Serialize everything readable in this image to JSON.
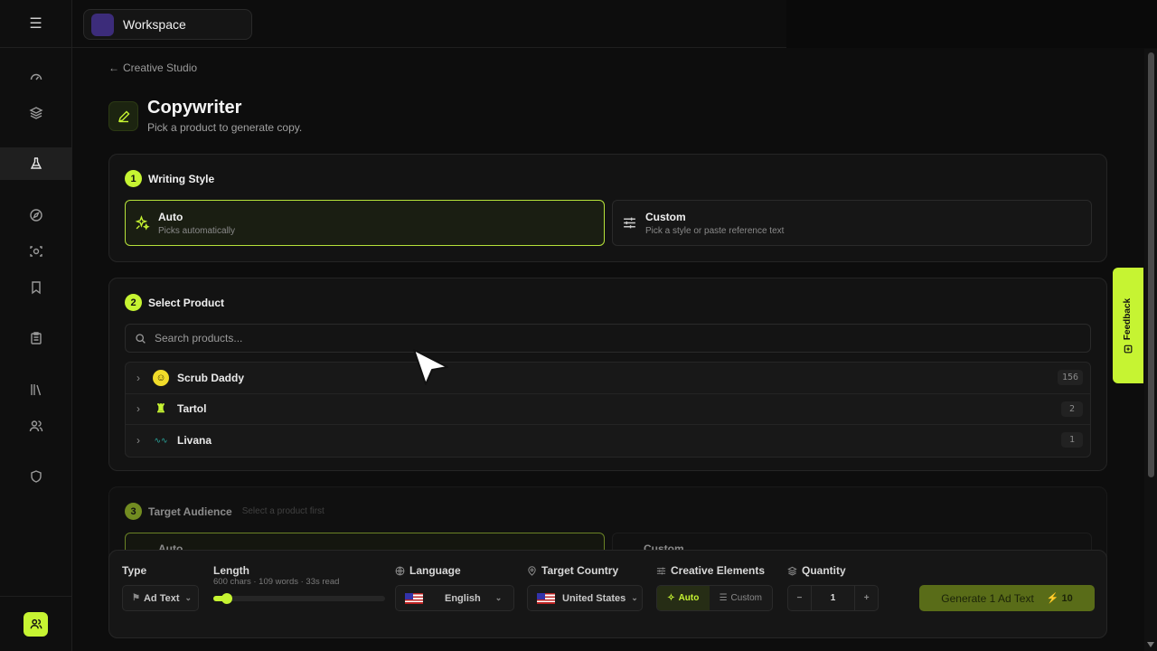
{
  "workspace": {
    "label": "Workspace"
  },
  "breadcrumb": {
    "back_label": "Creative Studio"
  },
  "page": {
    "title": "Copywriter",
    "subtitle": "Pick a product to generate copy."
  },
  "step1": {
    "num": "1",
    "title": "Writing Style",
    "options": [
      {
        "title": "Auto",
        "desc": "Picks automatically",
        "icon": "sparkles-icon",
        "selected": true
      },
      {
        "title": "Custom",
        "desc": "Pick a style or paste reference text",
        "icon": "sliders-icon",
        "selected": false
      }
    ]
  },
  "step2": {
    "num": "2",
    "title": "Select Product",
    "search_placeholder": "Search products...",
    "products": [
      {
        "name": "Scrub Daddy",
        "count": "156",
        "logo": "smiley-logo"
      },
      {
        "name": "Tartol",
        "count": "2",
        "logo": "castle-logo"
      },
      {
        "name": "Livana",
        "count": "1",
        "logo": "wave-logo"
      }
    ]
  },
  "step3": {
    "num": "3",
    "title": "Target Audience",
    "hint": "Select a product first",
    "options": [
      {
        "title": "Auto"
      },
      {
        "title": "Custom"
      }
    ]
  },
  "bottombar": {
    "type": {
      "label": "Type",
      "value": "Ad Text"
    },
    "length": {
      "label": "Length",
      "detail": "600 chars · 109 words · 33s read",
      "level": 0.05
    },
    "language": {
      "label": "Language",
      "value": "English"
    },
    "country": {
      "label": "Target Country",
      "value": "United States"
    },
    "elements": {
      "label": "Creative Elements",
      "auto": "Auto",
      "custom": "Custom"
    },
    "quantity": {
      "label": "Quantity",
      "minus": "−",
      "value": "1",
      "plus": "+"
    },
    "generate": {
      "label": "Generate 1 Ad Text",
      "credits": "10"
    }
  },
  "feedback": {
    "label": "Feedback"
  },
  "colors": {
    "accent": "#c6f432",
    "background": "#0d0d0d"
  }
}
